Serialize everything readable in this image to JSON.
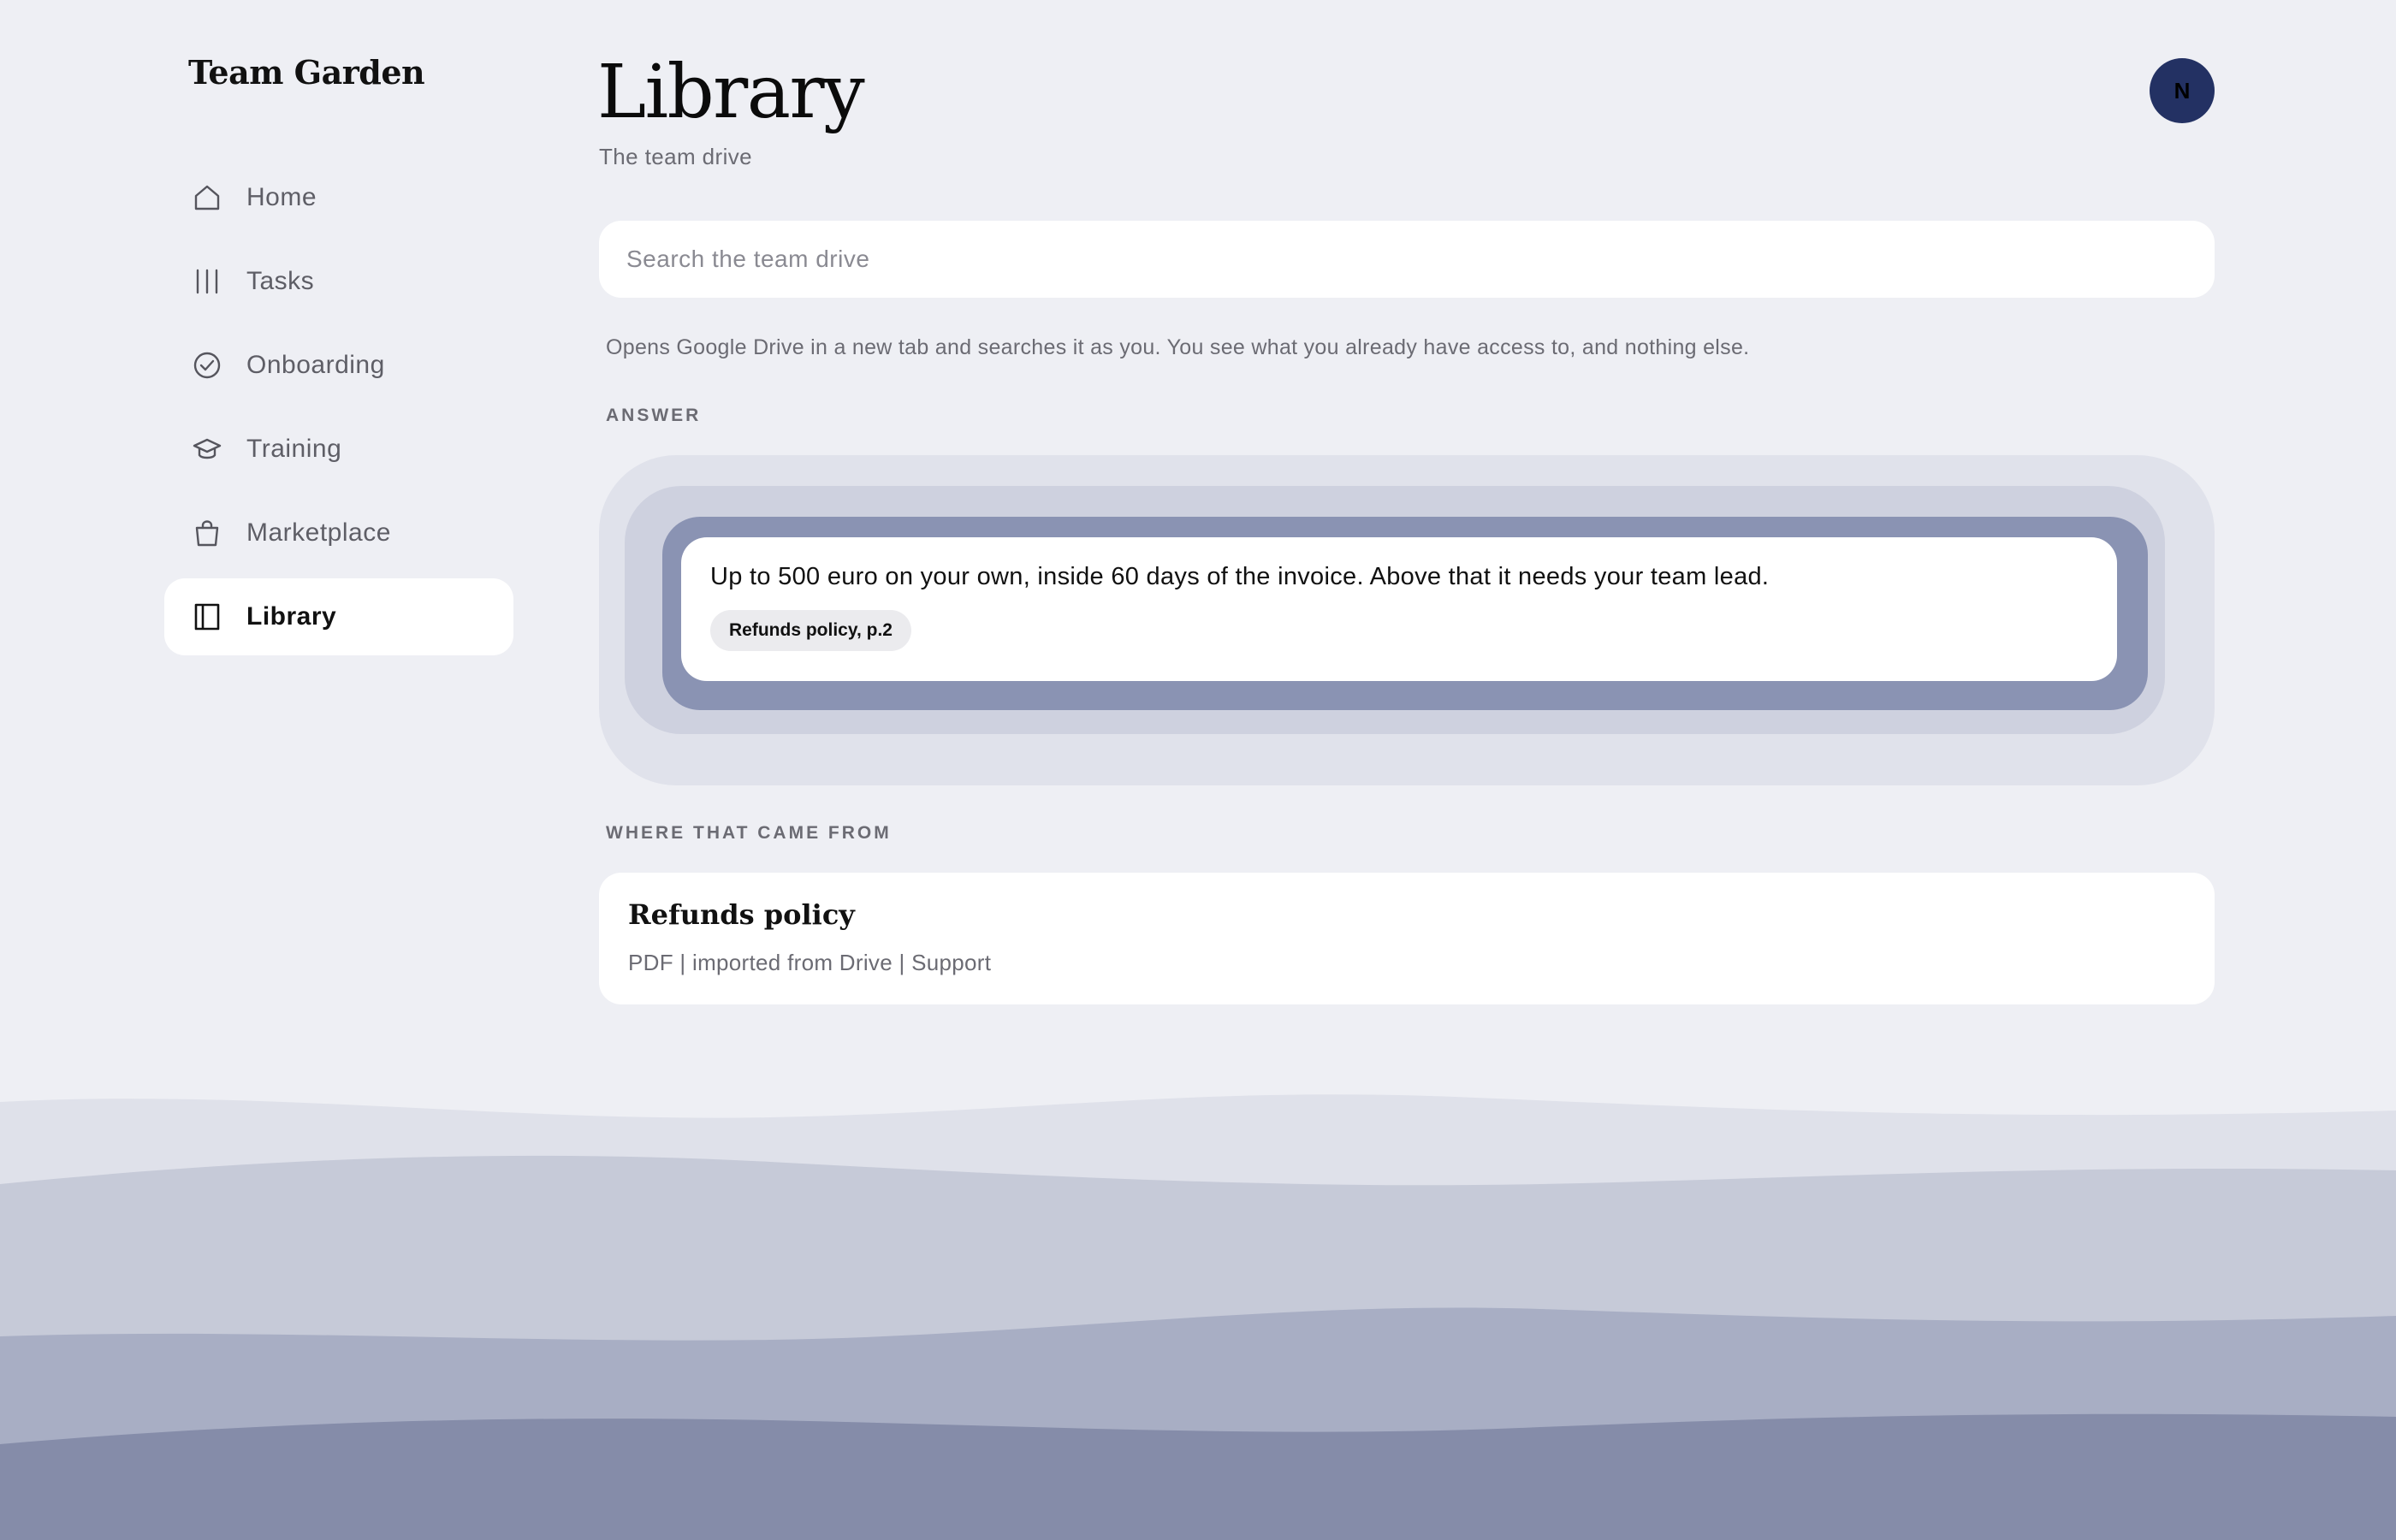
{
  "app": {
    "brand": "Team Garden"
  },
  "sidebar": {
    "items": [
      {
        "label": "Home",
        "icon": "home-icon",
        "active": false
      },
      {
        "label": "Tasks",
        "icon": "tasks-icon",
        "active": false
      },
      {
        "label": "Onboarding",
        "icon": "check-circle-icon",
        "active": false
      },
      {
        "label": "Training",
        "icon": "graduation-cap-icon",
        "active": false
      },
      {
        "label": "Marketplace",
        "icon": "shopping-bag-icon",
        "active": false
      },
      {
        "label": "Library",
        "icon": "book-icon",
        "active": true
      }
    ]
  },
  "header": {
    "title": "Library",
    "subtitle": "The team drive",
    "avatar_initial": "N"
  },
  "search": {
    "placeholder": "Search the team drive",
    "value": "",
    "helper": "Opens Google Drive in a new tab and searches it as you. You see what you already have access to, and nothing else."
  },
  "answer": {
    "section_label": "ANSWER",
    "text": "Up to 500 euro on your own, inside 60 days of the invoice. Above that it needs your team lead.",
    "citation": "Refunds policy, p.2"
  },
  "sources": {
    "section_label": "WHERE THAT CAME FROM",
    "items": [
      {
        "title": "Refunds policy",
        "meta": "PDF | imported from Drive | Support"
      }
    ]
  },
  "colors": {
    "background": "#eeeff4",
    "avatar": "#233163",
    "answer_ring_outer": "#e0e2eb",
    "answer_ring_middle": "#ced1df",
    "answer_ring_inner": "#8a93b3",
    "wave_1": "#dfe1ea",
    "wave_2": "#c6cad8",
    "wave_3": "#a8aec4",
    "wave_4": "#858ca9"
  }
}
